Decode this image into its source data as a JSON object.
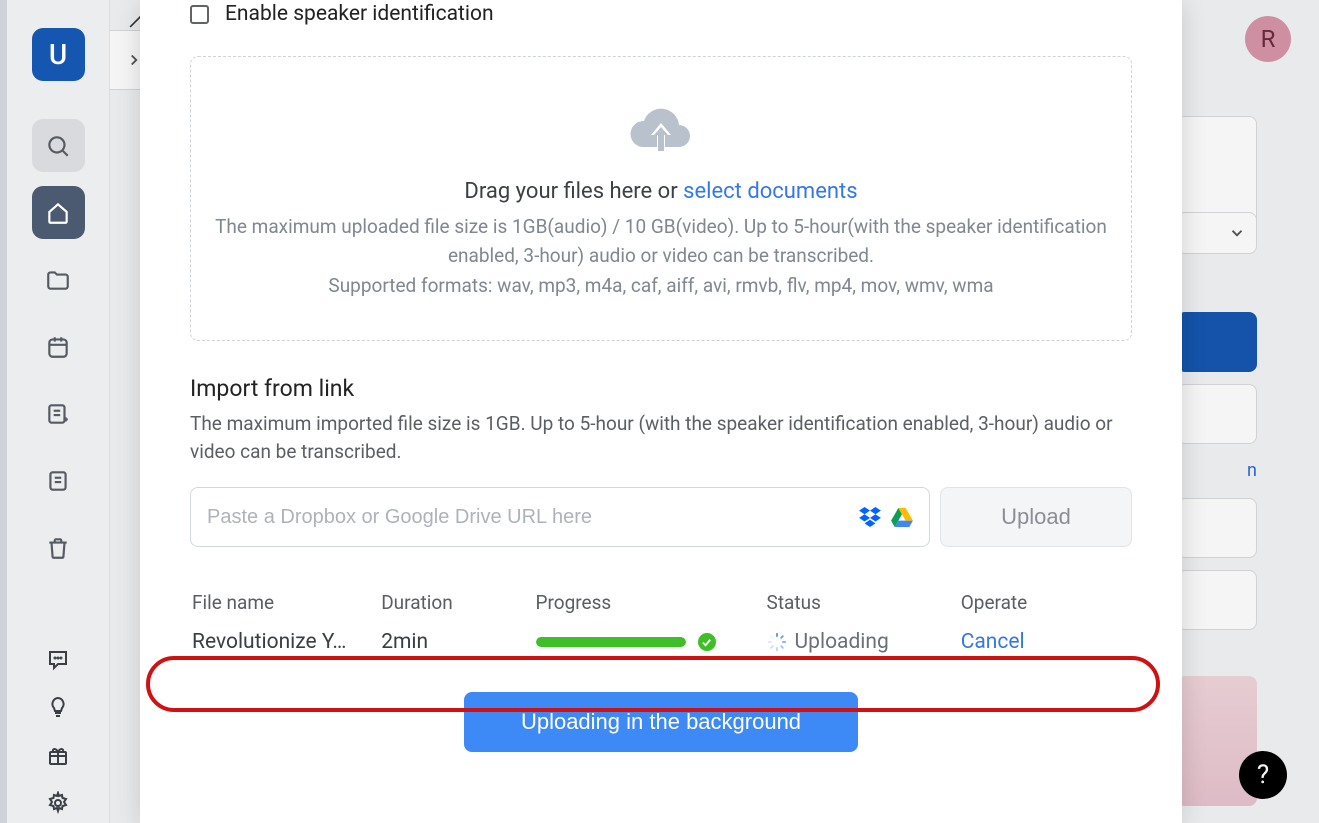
{
  "sidebar": {
    "logo": "U"
  },
  "avatar_letter": "R",
  "bg_link_text": "n",
  "modal": {
    "speaker_label": "Enable speaker identification",
    "dropzone": {
      "main_pre": "Drag your files here or ",
      "select_link": "select documents",
      "note1": "The maximum uploaded file size is 1GB(audio) / 10 GB(video). Up to 5-hour(with the speaker identification enabled, 3-hour) audio or video can be transcribed.",
      "note2": "Supported formats: wav, mp3, m4a, caf, aiff, avi, rmvb, flv, mp4, mov, wmv, wma"
    },
    "import": {
      "heading": "Import from link",
      "note": "The maximum imported file size is 1GB. Up to 5-hour (with the speaker identification enabled, 3-hour) audio or video can be transcribed.",
      "placeholder": "Paste a Dropbox or Google Drive URL here",
      "upload_btn": "Upload"
    },
    "table": {
      "headers": {
        "name": "File name",
        "dur": "Duration",
        "prog": "Progress",
        "stat": "Status",
        "op": "Operate"
      },
      "row": {
        "name": "Revolutionize Y…",
        "dur": "2min",
        "status": "Uploading",
        "cancel": "Cancel"
      }
    },
    "bg_button": "Uploading in the background"
  }
}
